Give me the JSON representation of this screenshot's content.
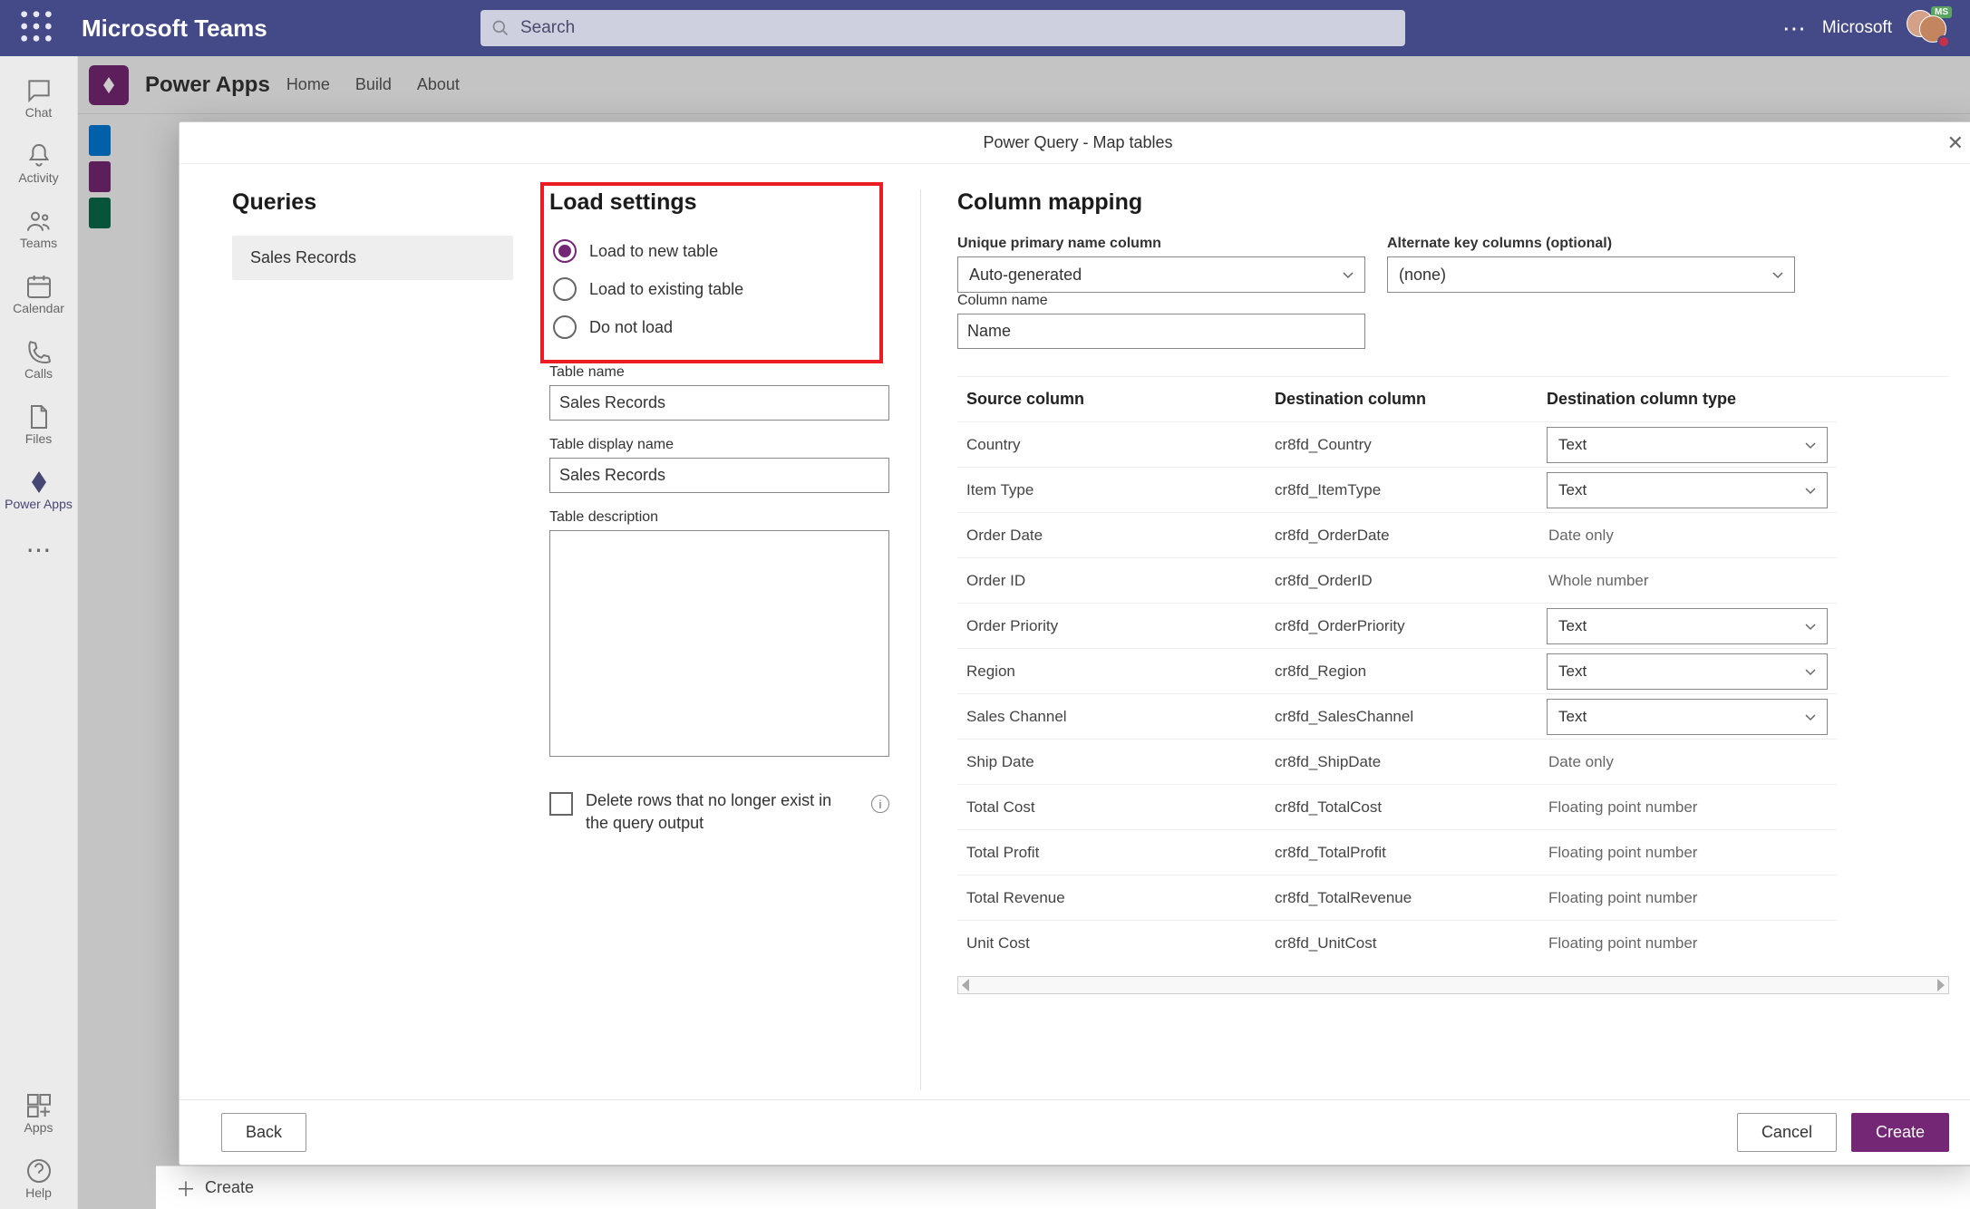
{
  "title_bar": {
    "app_name": "Microsoft Teams",
    "search_placeholder": "Search",
    "org_label": "Microsoft",
    "avatar_badge": "MS"
  },
  "left_rail": {
    "items": [
      {
        "label": "Chat"
      },
      {
        "label": "Activity"
      },
      {
        "label": "Teams"
      },
      {
        "label": "Calendar"
      },
      {
        "label": "Calls"
      },
      {
        "label": "Files"
      },
      {
        "label": "Power Apps"
      }
    ],
    "bottom": [
      {
        "label": "Apps"
      },
      {
        "label": "Help"
      }
    ]
  },
  "power_apps_header": {
    "title": "Power Apps",
    "nav": [
      "Home",
      "Build",
      "About"
    ]
  },
  "bottom_bar": {
    "create_label": "Create"
  },
  "modal": {
    "title": "Power Query - Map tables",
    "queries": {
      "heading": "Queries",
      "items": [
        "Sales Records"
      ]
    },
    "load_settings": {
      "heading": "Load settings",
      "options": [
        {
          "label": "Load to new table",
          "selected": true
        },
        {
          "label": "Load to existing table",
          "selected": false
        },
        {
          "label": "Do not load",
          "selected": false
        }
      ],
      "table_name_label": "Table name",
      "table_name_value": "Sales Records",
      "table_display_label": "Table display name",
      "table_display_value": "Sales Records",
      "table_desc_label": "Table description",
      "delete_rows_label": "Delete rows that no longer exist in the query output"
    },
    "column_mapping": {
      "heading": "Column mapping",
      "unique_label": "Unique primary name column",
      "unique_value": "Auto-generated",
      "alt_label": "Alternate key columns (optional)",
      "alt_value": "(none)",
      "column_name_label": "Column name",
      "column_name_value": "Name",
      "headers": {
        "source": "Source column",
        "dest": "Destination column",
        "type": "Destination column type"
      },
      "rows": [
        {
          "source": "Country",
          "dest": "cr8fd_Country",
          "type": "Text",
          "editable": true
        },
        {
          "source": "Item Type",
          "dest": "cr8fd_ItemType",
          "type": "Text",
          "editable": true
        },
        {
          "source": "Order Date",
          "dest": "cr8fd_OrderDate",
          "type": "Date only",
          "editable": false
        },
        {
          "source": "Order ID",
          "dest": "cr8fd_OrderID",
          "type": "Whole number",
          "editable": false
        },
        {
          "source": "Order Priority",
          "dest": "cr8fd_OrderPriority",
          "type": "Text",
          "editable": true
        },
        {
          "source": "Region",
          "dest": "cr8fd_Region",
          "type": "Text",
          "editable": true
        },
        {
          "source": "Sales Channel",
          "dest": "cr8fd_SalesChannel",
          "type": "Text",
          "editable": true
        },
        {
          "source": "Ship Date",
          "dest": "cr8fd_ShipDate",
          "type": "Date only",
          "editable": false
        },
        {
          "source": "Total Cost",
          "dest": "cr8fd_TotalCost",
          "type": "Floating point number",
          "editable": false
        },
        {
          "source": "Total Profit",
          "dest": "cr8fd_TotalProfit",
          "type": "Floating point number",
          "editable": false
        },
        {
          "source": "Total Revenue",
          "dest": "cr8fd_TotalRevenue",
          "type": "Floating point number",
          "editable": false
        },
        {
          "source": "Unit Cost",
          "dest": "cr8fd_UnitCost",
          "type": "Floating point number",
          "editable": false
        }
      ]
    },
    "footer": {
      "back": "Back",
      "cancel": "Cancel",
      "create": "Create"
    }
  }
}
